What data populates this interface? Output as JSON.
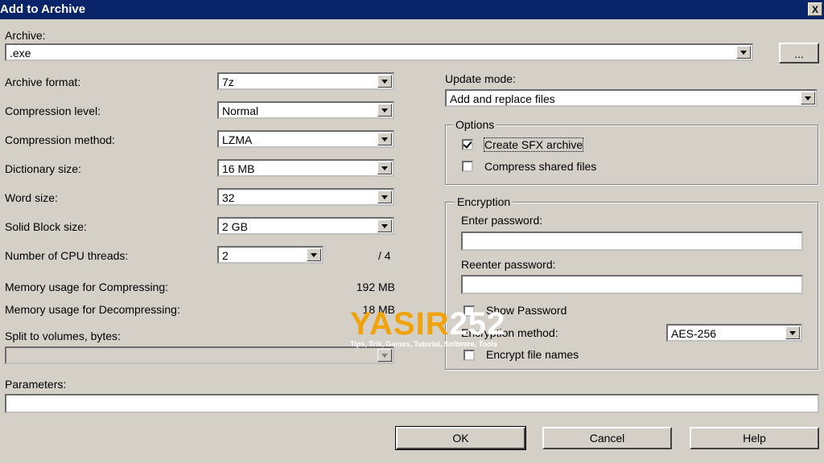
{
  "window": {
    "title": "Add to Archive",
    "close_glyph": "X"
  },
  "archive": {
    "label": "Archive:",
    "value": ".exe",
    "browse_label": "..."
  },
  "left": {
    "archive_format": {
      "label": "Archive format:",
      "value": "7z"
    },
    "compression_level": {
      "label": "Compression level:",
      "value": "Normal"
    },
    "compression_method": {
      "label": "Compression method:",
      "value": "LZMA"
    },
    "dictionary_size": {
      "label": "Dictionary size:",
      "value": "16 MB"
    },
    "word_size": {
      "label": "Word size:",
      "value": "32"
    },
    "solid_block_size": {
      "label": "Solid Block size:",
      "value": "2 GB"
    },
    "cpu_threads": {
      "label": "Number of CPU threads:",
      "value": "2",
      "max": "/ 4"
    },
    "mem_compress": {
      "label": "Memory usage for Compressing:",
      "value": "192 MB"
    },
    "mem_decompress": {
      "label": "Memory usage for Decompressing:",
      "value": "18 MB"
    },
    "split": {
      "label": "Split to volumes, bytes:",
      "value": ""
    }
  },
  "parameters": {
    "label": "Parameters:",
    "value": ""
  },
  "update_mode": {
    "label": "Update mode:",
    "value": "Add and replace files"
  },
  "options": {
    "title": "Options",
    "create_sfx": {
      "label": "Create SFX archive",
      "checked": true
    },
    "compress_shared": {
      "label": "Compress shared files",
      "checked": false
    }
  },
  "encryption": {
    "title": "Encryption",
    "enter_password_label": "Enter password:",
    "reenter_password_label": "Reenter password:",
    "password": "",
    "password_confirm": "",
    "show_password": {
      "label": "Show Password",
      "checked": false
    },
    "method_label": "Encryption method:",
    "method_value": "AES-256",
    "encrypt_names": {
      "label": "Encrypt file names",
      "checked": false
    }
  },
  "buttons": {
    "ok": "OK",
    "cancel": "Cancel",
    "help": "Help"
  },
  "watermark": {
    "brand": "YASIR",
    "number": "252",
    "tagline": "Tips, Trik, Games, Tutorial, Software, Tools",
    "brand_color": "#f0a30a"
  }
}
